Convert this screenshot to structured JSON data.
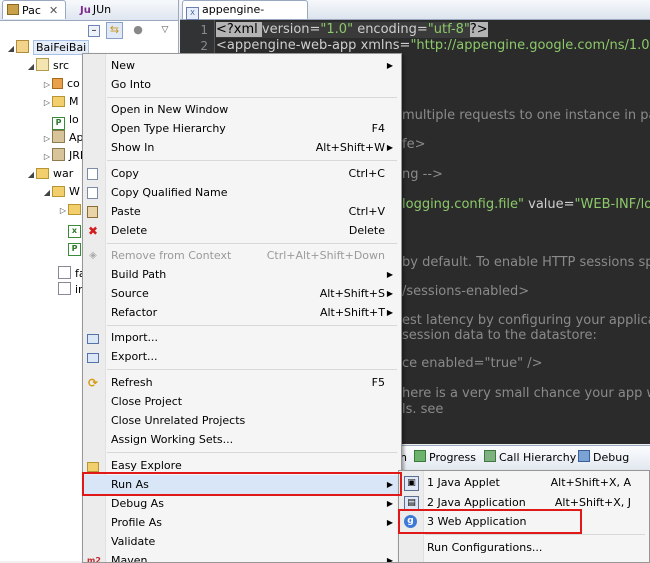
{
  "left_panel": {
    "tab_package": "Pac",
    "tab_close": "✕",
    "tab_junit": "JUn",
    "tab_junit_prefix": "Ju",
    "tree": {
      "project": "BaiFeiBai",
      "src": "src",
      "pkg1": "co",
      "pkg2": "M",
      "file1": "lo",
      "appengine": "App",
      "jre": "JRE S",
      "war": "war",
      "webinf": "W",
      "fa": "fa",
      "index": "in"
    }
  },
  "editor": {
    "tab_label": "appengine-web.xml",
    "line_numbers": [
      "1",
      "2"
    ],
    "line1_pre": "<?xml ",
    "line1_attr1": "version=",
    "line1_val1": "\"1.0\"",
    "line1_attr2": " encoding=",
    "line1_val2": "\"utf-8\"",
    "line1_end": "?>",
    "line2_tag": "<appengine-web-app ",
    "line2_attr": "xmlns=",
    "line2_val": "\"http://appengine.google.com/ns/1.0\"",
    "line2_end": ">",
    "frag_multiple": "multiple requests to one instance in paral",
    "frag_fe": "fe>",
    "frag_ng": "ng -->",
    "frag_logging_val": "logging.config.file\"",
    "frag_logging_attr": " value=",
    "frag_logging_val2": "\"WEB-INF/loggi",
    "frag_default": "by default. To enable HTTP sessions spe",
    "frag_sessions": "/sessions-enabled>",
    "frag_latency": "est latency by configuring your applicatio",
    "frag_session_data": "session data to the datastore:",
    "frag_enabled": "ce enabled=\"true\" />",
    "frag_small": "here is a very small chance your app will s",
    "frag_ellipsis": "ls. see"
  },
  "context_menu": {
    "items": [
      {
        "label": "New",
        "shortcut": "",
        "submenu": true
      },
      {
        "label": "Go Into",
        "shortcut": ""
      },
      {
        "label": "Open in New Window",
        "shortcut": ""
      },
      {
        "label": "Open Type Hierarchy",
        "shortcut": "F4"
      },
      {
        "label": "Show In",
        "shortcut": "Alt+Shift+W",
        "submenu": true
      },
      {
        "label": "Copy",
        "shortcut": "Ctrl+C"
      },
      {
        "label": "Copy Qualified Name",
        "shortcut": ""
      },
      {
        "label": "Paste",
        "shortcut": "Ctrl+V"
      },
      {
        "label": "Delete",
        "shortcut": "Delete"
      },
      {
        "label": "Remove from Context",
        "shortcut": "Ctrl+Alt+Shift+Down"
      },
      {
        "label": "Build Path",
        "shortcut": "",
        "submenu": true
      },
      {
        "label": "Source",
        "shortcut": "Alt+Shift+S",
        "submenu": true
      },
      {
        "label": "Refactor",
        "shortcut": "Alt+Shift+T",
        "submenu": true
      },
      {
        "label": "Import...",
        "shortcut": ""
      },
      {
        "label": "Export...",
        "shortcut": ""
      },
      {
        "label": "Refresh",
        "shortcut": "F5"
      },
      {
        "label": "Close Project",
        "shortcut": ""
      },
      {
        "label": "Close Unrelated Projects",
        "shortcut": ""
      },
      {
        "label": "Assign Working Sets...",
        "shortcut": ""
      },
      {
        "label": "Easy Explore",
        "shortcut": ""
      },
      {
        "label": "Run As",
        "shortcut": "",
        "submenu": true
      },
      {
        "label": "Debug As",
        "shortcut": "",
        "submenu": true
      },
      {
        "label": "Profile As",
        "shortcut": "",
        "submenu": true
      },
      {
        "label": "Validate",
        "shortcut": ""
      },
      {
        "label": "Maven",
        "shortcut": "",
        "submenu": true
      }
    ],
    "submenu_arrow": "▶"
  },
  "run_as_submenu": {
    "items": [
      {
        "label": "1 Java Applet",
        "shortcut": "Alt+Shift+X, A"
      },
      {
        "label": "2 Java Application",
        "shortcut": "Alt+Shift+X, J"
      },
      {
        "label": "3 Web Application",
        "shortcut": ""
      },
      {
        "label": "Run Configurations...",
        "shortcut": ""
      }
    ]
  },
  "bottom_panel": {
    "tab_h": "h",
    "tab_progress": "Progress",
    "tab_call_hierarchy": "Call Hierarchy",
    "tab_debug": "Debug"
  },
  "colors": {
    "highlight_box": "#e01818",
    "editor_bg": "#2b2b2b",
    "xml_value": "#8cc96a"
  },
  "icons": {
    "new": "none",
    "copy": "copy-icon",
    "paste": "paste-icon",
    "delete": "red-x-icon",
    "import": "import-icon",
    "export": "export-icon",
    "refresh": "refresh-icon",
    "easy_explore": "folder-icon",
    "maven": "m2-icon",
    "web_app": "google-icon"
  }
}
